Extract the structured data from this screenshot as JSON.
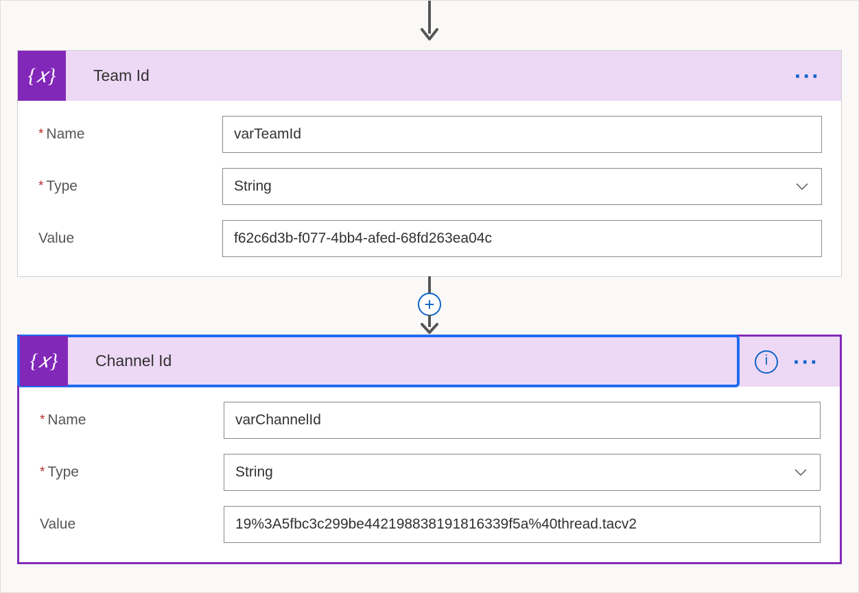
{
  "colors": {
    "accent": "#1f6cf0",
    "brand": "#8228b9",
    "header_bg": "#edd8f6",
    "required": "#b62f2d"
  },
  "icons": {
    "variable": "{𝑥}",
    "more": "···",
    "plus": "+",
    "info": "i"
  },
  "labels": {
    "name": "Name",
    "type": "Type",
    "value": "Value",
    "required_marker": "*"
  },
  "cards": [
    {
      "title": "Team Id",
      "selected": false,
      "show_info": false,
      "fields": {
        "name": {
          "required": true,
          "value": "varTeamId"
        },
        "type": {
          "required": true,
          "value": "String"
        },
        "value": {
          "required": false,
          "value": "f62c6d3b-f077-4bb4-afed-68fd263ea04c"
        }
      }
    },
    {
      "title": "Channel Id",
      "selected": true,
      "show_info": true,
      "fields": {
        "name": {
          "required": true,
          "value": "varChannelId"
        },
        "type": {
          "required": true,
          "value": "String"
        },
        "value": {
          "required": false,
          "value": "19%3A5fbc3c299be442198838191816339f5a%40thread.tacv2"
        }
      }
    }
  ]
}
